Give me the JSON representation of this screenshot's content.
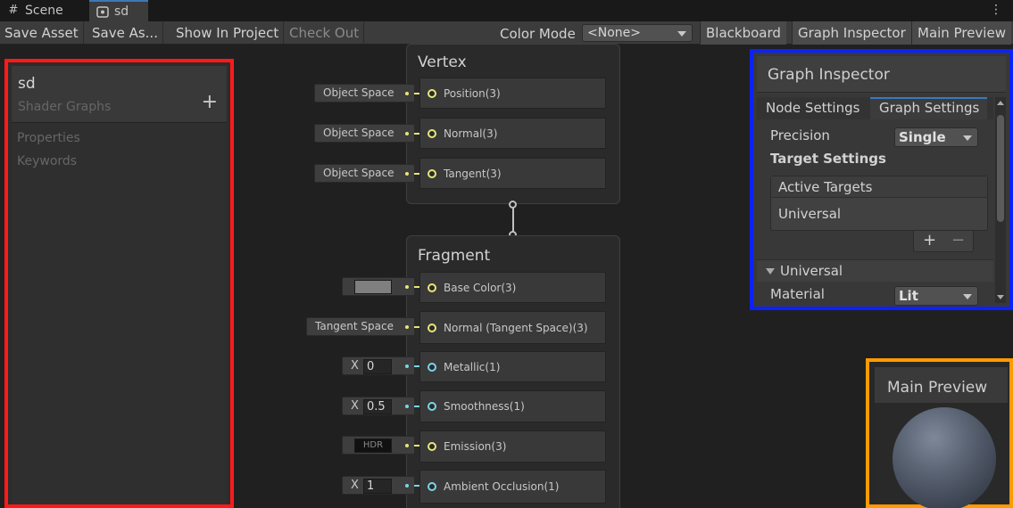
{
  "tabs": [
    {
      "label": "Scene",
      "icon": "grid-icon"
    },
    {
      "label": "sd",
      "icon": "shader-graph-icon"
    }
  ],
  "toolbar": {
    "save_asset": "Save Asset",
    "save_as": "Save As...",
    "show_in_project": "Show In Project",
    "check_out": "Check Out",
    "color_mode_label": "Color Mode",
    "color_mode_value": "<None>",
    "blackboard": "Blackboard",
    "graph_inspector": "Graph Inspector",
    "main_preview": "Main Preview"
  },
  "blackboard": {
    "title": "sd",
    "subtitle": "Shader Graphs",
    "add_symbol": "+",
    "sections": [
      "Properties",
      "Keywords"
    ]
  },
  "vertex": {
    "title": "Vertex",
    "blocks": [
      {
        "label": "Position(3)",
        "input": "Object Space"
      },
      {
        "label": "Normal(3)",
        "input": "Object Space"
      },
      {
        "label": "Tangent(3)",
        "input": "Object Space"
      }
    ]
  },
  "fragment": {
    "title": "Fragment",
    "blocks": [
      {
        "label": "Base Color(3)"
      },
      {
        "label": "Normal (Tangent Space)(3)",
        "input": "Tangent Space"
      },
      {
        "label": "Metallic(1)",
        "axis": "X",
        "value": "0"
      },
      {
        "label": "Smoothness(1)",
        "axis": "X",
        "value": "0.5"
      },
      {
        "label": "Emission(3)",
        "input": "HDR"
      },
      {
        "label": "Ambient Occlusion(1)",
        "axis": "X",
        "value": "1"
      }
    ]
  },
  "inspector": {
    "title": "Graph Inspector",
    "tab_node": "Node Settings",
    "tab_graph": "Graph Settings",
    "precision_label": "Precision",
    "precision_value": "Single",
    "target_settings": "Target Settings",
    "active_targets": "Active Targets",
    "target_item": "Universal",
    "plus": "+",
    "minus": "−",
    "universal_section": "Universal",
    "material_label": "Material",
    "material_value": "Lit"
  },
  "preview": {
    "title": "Main Preview"
  },
  "colors": {
    "blackboard_highlight": "#ff1a1a",
    "inspector_highlight": "#0a22ff",
    "preview_highlight": "#ff9a00",
    "vector3_port": "#e6e67a",
    "float_port": "#78d6e6",
    "active_tab_accent": "#3a79bb"
  }
}
